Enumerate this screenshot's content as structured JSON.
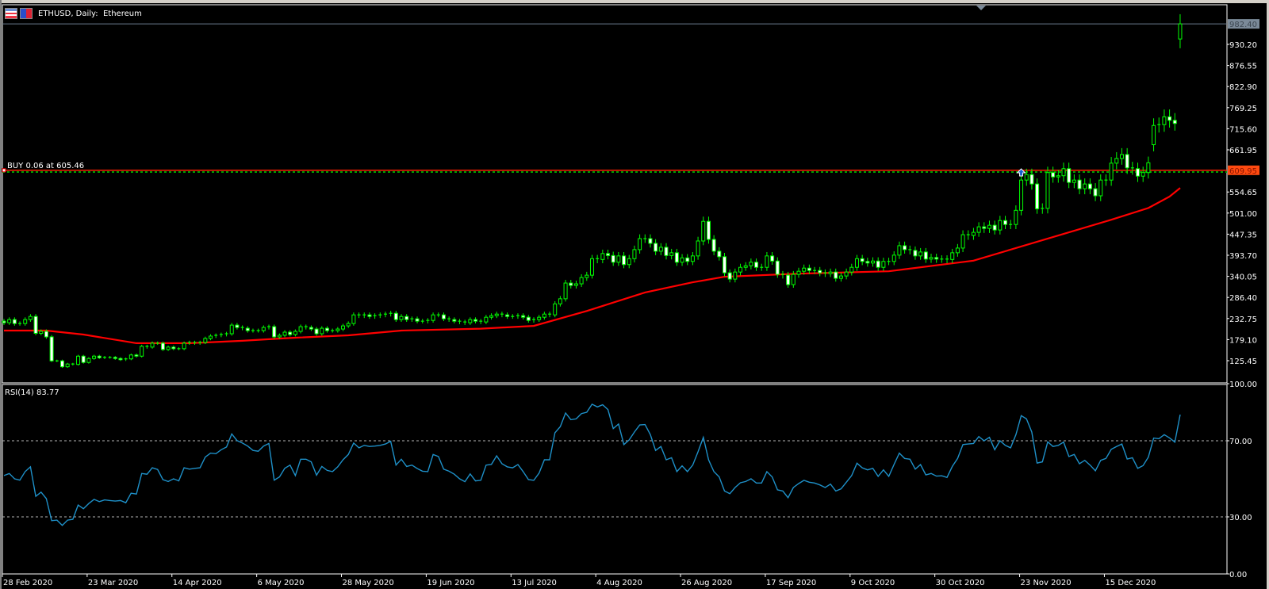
{
  "window": {
    "title": "ETHUSD, Daily:  Ethereum",
    "icons": [
      "chart-list-icon",
      "ethereum-symbol-icon"
    ]
  },
  "colors": {
    "background": "#000000",
    "bull_outline": "#00ff00",
    "bear_fill": "#ffffff",
    "ma_line": "#ff0000",
    "rsi_line": "#1e90c8",
    "grid_level": "#b4b4b4",
    "current_price_bg": "#7b8a99",
    "bid_label_bg": "#ff4a10",
    "order_line": "#00a000",
    "axis": "#ffffff"
  },
  "trade": {
    "order_label": "BUY 0.06 at 605.46",
    "order_price": 605.46,
    "bid_line_price": 609.95,
    "bid_label": "609.95",
    "current_price": 982.4,
    "current_price_label": "982.40",
    "entry_bar": 192,
    "entry_icon": "buy-arrow-icon"
  },
  "chart_data": [
    {
      "type": "candlestick",
      "title": "ETHUSD, Daily:  Ethereum",
      "ylim": [
        100,
        1000
      ],
      "price_ticks": [
        "930.20",
        "876.55",
        "822.90",
        "769.25",
        "715.60",
        "661.95",
        "554.65",
        "501.00",
        "447.35",
        "393.70",
        "340.05",
        "286.40",
        "232.75",
        "179.10",
        "125.45"
      ],
      "date_labels": [
        "28 Feb 2020",
        "23 Mar 2020",
        "14 Apr 2020",
        "6 May 2020",
        "28 May 2020",
        "19 Jun 2020",
        "13 Jul 2020",
        "4 Aug 2020",
        "26 Aug 2020",
        "17 Sep 2020",
        "9 Oct 2020",
        "30 Oct 2020",
        "23 Nov 2020",
        "15 Dec 2020"
      ],
      "date_label_every_bars": 16,
      "first_open": 226,
      "open_gaps": {
        "217": 675,
        "222": 944
      },
      "close": [
        222,
        230,
        220,
        220,
        230,
        238,
        195,
        200,
        186,
        125,
        125,
        110,
        117,
        116,
        137,
        121,
        131,
        137,
        133,
        134,
        134,
        131,
        128,
        130,
        140,
        137,
        162,
        160,
        170,
        170,
        154,
        160,
        156,
        156,
        170,
        172,
        170,
        172,
        182,
        188,
        190,
        192,
        194,
        216,
        210,
        208,
        202,
        202,
        202,
        210,
        212,
        186,
        190,
        198,
        192,
        200,
        212,
        210,
        206,
        194,
        208,
        202,
        202,
        206,
        214,
        220,
        242,
        240,
        242,
        238,
        240,
        242,
        244,
        246,
        230,
        238,
        230,
        232,
        226,
        226,
        228,
        242,
        242,
        232,
        230,
        226,
        224,
        222,
        230,
        226,
        224,
        236,
        240,
        244,
        242,
        238,
        238,
        240,
        236,
        228,
        230,
        236,
        244,
        242,
        270,
        283,
        323,
        317,
        321,
        337,
        343,
        385,
        383,
        398,
        393,
        376,
        392,
        370,
        385,
        408,
        436,
        436,
        424,
        404,
        414,
        393,
        400,
        376,
        387,
        378,
        392,
        430,
        480,
        434,
        404,
        390,
        349,
        333,
        351,
        363,
        367,
        376,
        363,
        363,
        392,
        379,
        345,
        343,
        319,
        345,
        353,
        361,
        355,
        355,
        349,
        347,
        351,
        335,
        341,
        351,
        363,
        385,
        378,
        374,
        379,
        363,
        378,
        378,
        394,
        418,
        408,
        406,
        392,
        402,
        384,
        388,
        384,
        384,
        383,
        400,
        412,
        446,
        444,
        452,
        466,
        462,
        470,
        458,
        482,
        472,
        472,
        508,
        585,
        599,
        575,
        512,
        513,
        604,
        593,
        596,
        614,
        579,
        585,
        563,
        575,
        563,
        545,
        585,
        585,
        628,
        640,
        650,
        616,
        614,
        595,
        604,
        629,
        724,
        726,
        746,
        737,
        729,
        982.4
      ],
      "moving_average": {
        "name": "MA",
        "points": [
          [
            0,
            202
          ],
          [
            8,
            202
          ],
          [
            15,
            192
          ],
          [
            25,
            170
          ],
          [
            35,
            170
          ],
          [
            45,
            176
          ],
          [
            50,
            180
          ],
          [
            55,
            184
          ],
          [
            65,
            190
          ],
          [
            75,
            202
          ],
          [
            90,
            207
          ],
          [
            100,
            214
          ],
          [
            110,
            252
          ],
          [
            121,
            299
          ],
          [
            130,
            325
          ],
          [
            136,
            339
          ],
          [
            150,
            347
          ],
          [
            167,
            353
          ],
          [
            183,
            380
          ],
          [
            200,
            448
          ],
          [
            209,
            484
          ],
          [
            216,
            514
          ],
          [
            220,
            543
          ],
          [
            222,
            565
          ]
        ]
      }
    },
    {
      "type": "line",
      "title": "RSI(14) 83.77",
      "ylim": [
        0,
        100
      ],
      "levels": [
        70,
        30
      ],
      "y_ticks": [
        "100.00",
        "70.00",
        "30.00",
        "0.00"
      ],
      "y_tick_values": [
        100,
        70,
        30,
        0
      ],
      "values": [
        51.7,
        52.8,
        50,
        49.3,
        53.8,
        56.3,
        40.8,
        43,
        39.6,
        28,
        28.3,
        25.5,
        28.3,
        28.7,
        36.2,
        34.3,
        37,
        39.2,
        38,
        38.9,
        38.6,
        38.3,
        38.6,
        37.4,
        42.4,
        42,
        52.8,
        52.4,
        55.8,
        54.9,
        49.6,
        48.6,
        50,
        48.9,
        55.8,
        55.1,
        55.5,
        55.8,
        61.4,
        63.5,
        63.2,
        65.3,
        66.7,
        73.6,
        70.1,
        68.8,
        67.2,
        64.9,
        64.5,
        67.2,
        68.6,
        49.3,
        51,
        55.5,
        57.2,
        51.7,
        60.3,
        60.3,
        58.9,
        51.9,
        56.5,
        54.4,
        53.8,
        56.3,
        60,
        62.8,
        68.8,
        66.3,
        67.6,
        67,
        67.2,
        67.6,
        68.3,
        69.7,
        57.2,
        60.3,
        56.5,
        57.2,
        55.4,
        54,
        53.8,
        62.8,
        61.7,
        55.1,
        54,
        52.4,
        50,
        48.5,
        52.6,
        48.9,
        49.2,
        57.2,
        57.6,
        62.1,
        57.9,
        56.3,
        55.8,
        57.5,
        53.8,
        49.6,
        49.2,
        53,
        60,
        60,
        74.2,
        77.4,
        84.6,
        81.1,
        81.5,
        84.3,
        85,
        89.2,
        87.8,
        88.9,
        86.4,
        76.4,
        78.8,
        68,
        70.4,
        74.6,
        78.3,
        78.5,
        73.2,
        64.9,
        67,
        60,
        61.1,
        53.8,
        56.8,
        53.8,
        57.2,
        64.2,
        71.8,
        60,
        53.8,
        51,
        43.6,
        42.2,
        45.4,
        47.9,
        48.6,
        50,
        47.8,
        47.8,
        53.8,
        51,
        44.2,
        43.6,
        40.1,
        45.4,
        47.5,
        49.2,
        48.2,
        47.8,
        46.8,
        45.4,
        47.2,
        43.6,
        44.7,
        48.2,
        51.7,
        58.2,
        55.8,
        54.7,
        55.5,
        51.3,
        54.7,
        51.3,
        57.5,
        63.5,
        60.7,
        60.3,
        55.1,
        57.5,
        52.1,
        52.8,
        51.4,
        51.6,
        50.7,
        56.5,
        60.7,
        68,
        68.3,
        68.6,
        72.2,
        70,
        71.8,
        65.3,
        70,
        67.6,
        66.3,
        73.2,
        83.2,
        81.5,
        74.6,
        58.3,
        58.9,
        69.4,
        67,
        67.6,
        69.3,
        61.7,
        62.8,
        57.9,
        59.7,
        57.2,
        54.2,
        59.7,
        60.7,
        65.5,
        67,
        68.3,
        60.4,
        61.1,
        55.5,
        56.9,
        61.4,
        71.4,
        71.1,
        73.2,
        71.5,
        69.3,
        83.77
      ]
    }
  ]
}
